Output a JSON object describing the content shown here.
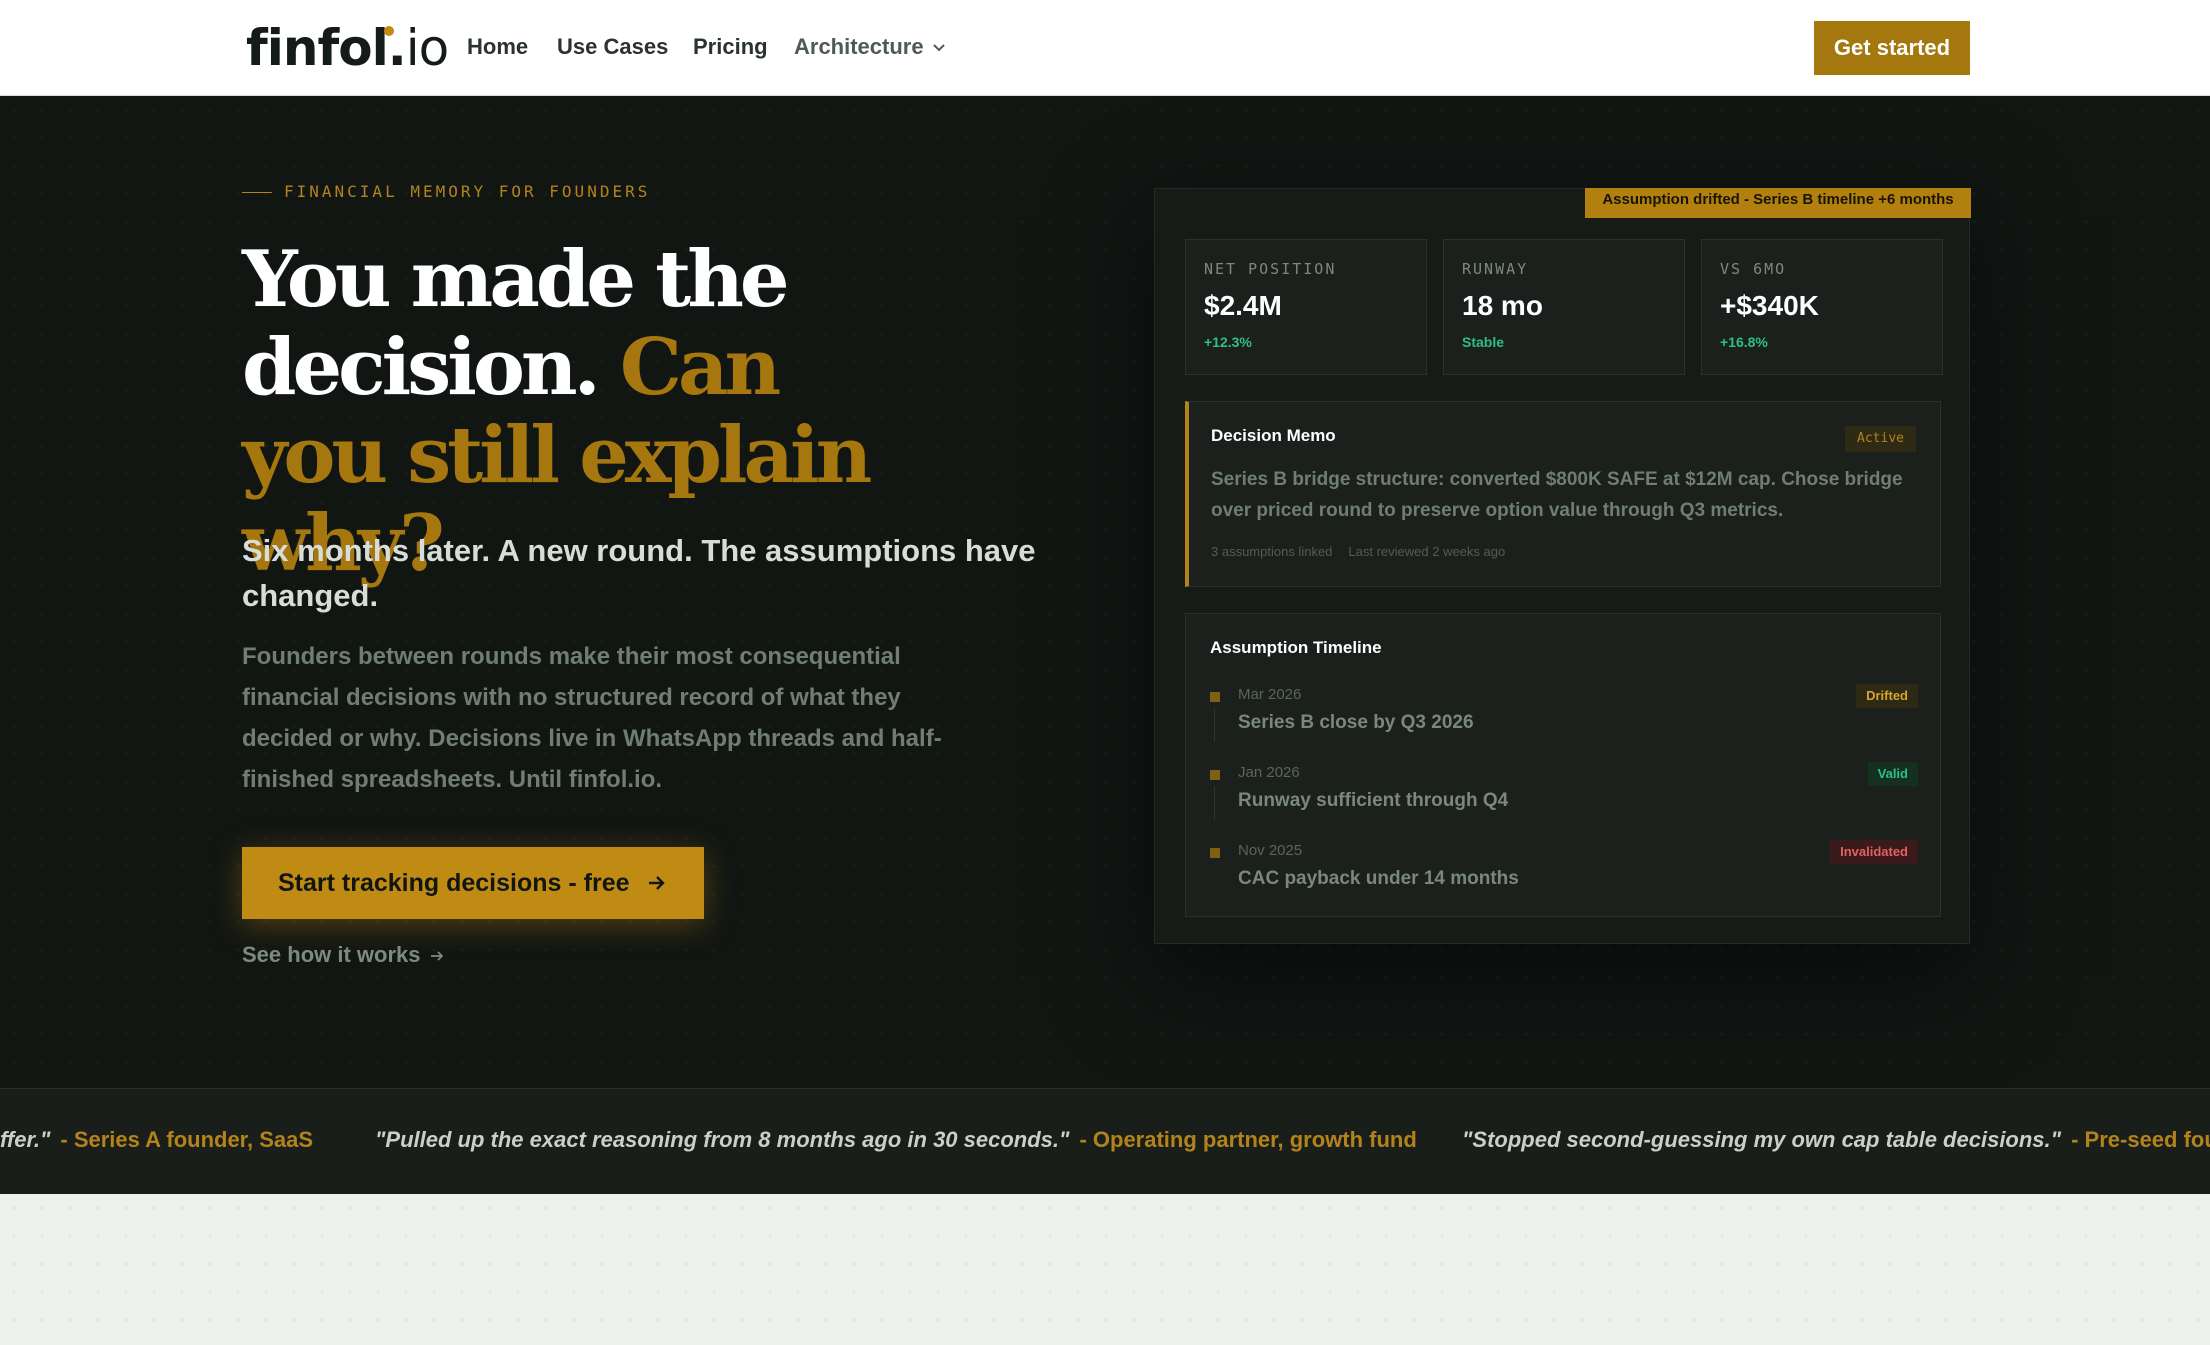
{
  "nav": {
    "logo_main": "finfol.",
    "logo_suffix": "io",
    "links": [
      "Home",
      "Use Cases",
      "Pricing",
      "Architecture"
    ],
    "cta": "Get started"
  },
  "hero": {
    "eyebrow": "FINANCIAL MEMORY FOR FOUNDERS",
    "headline_white": "You made the decision.",
    "headline_accent": "Can you still explain why?",
    "subhead": "Six months later. A new round. The assumptions have changed.",
    "body": "Founders between rounds make their most consequential financial decisions with no structured record of what they decided or why. Decisions live in WhatsApp threads and half-finished spreadsheets. Until finfol.io.",
    "cta_primary": "Start tracking decisions - free",
    "cta_secondary": "See how it works"
  },
  "dashboard": {
    "drift_banner": "Assumption drifted - Series B timeline +6 months",
    "stats": [
      {
        "label": "NET POSITION",
        "value": "$2.4M",
        "delta": "+12.3%"
      },
      {
        "label": "RUNWAY",
        "value": "18 mo",
        "delta": "Stable"
      },
      {
        "label": "VS 6MO",
        "value": "+$340K",
        "delta": "+16.8%"
      }
    ],
    "memo": {
      "title": "Decision Memo",
      "badge": "Active",
      "text": "Series B bridge structure: converted $800K SAFE at $12M cap. Chose bridge over priced round to preserve option value through Q3 metrics.",
      "meta_links": "3 assumptions linked",
      "meta_review": "Last reviewed 2 weeks ago"
    },
    "timeline": {
      "title": "Assumption Timeline",
      "items": [
        {
          "date": "Mar 2026",
          "text": "Series B close by Q3 2026",
          "status": "Drifted"
        },
        {
          "date": "Jan 2026",
          "text": "Runway sufficient through Q4",
          "status": "Valid"
        },
        {
          "date": "Nov 2025",
          "text": "CAC payback under 14 months",
          "status": "Invalidated"
        }
      ]
    }
  },
  "testimonials": [
    {
      "quote": "ffer.\"",
      "author": "- Series A founder, SaaS"
    },
    {
      "quote": "\"Pulled up the exact reasoning from 8 months ago in 30 seconds.\"",
      "author": "- Operating partner, growth fund"
    },
    {
      "quote": "\"Stopped second-guessing my own cap table decisions.\"",
      "author": "- Pre-seed foun"
    }
  ],
  "colors": {
    "accent": "#b3831b",
    "hero_bg": "#121613",
    "positive": "#2fbf84",
    "negative": "#e16060"
  }
}
